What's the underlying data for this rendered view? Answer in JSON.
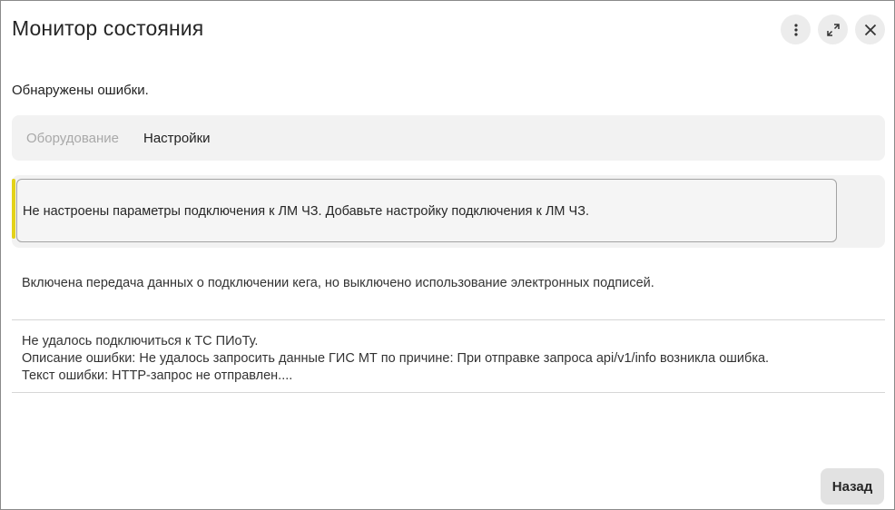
{
  "window": {
    "title": "Монитор состояния"
  },
  "summary": "Обнаружены ошибки.",
  "tabs": [
    {
      "label": "Оборудование",
      "active": false
    },
    {
      "label": "Настройки",
      "active": true
    }
  ],
  "messages": {
    "highlighted": "Не настроены параметры подключения к ЛМ ЧЗ. Добавьте настройку подключения к ЛМ ЧЗ.",
    "keg": "Включена передача данных о подключении кега, но выключено использование электронных подписей.",
    "piot": {
      "line1": "Не удалось подключиться к ТС ПИоТу.",
      "line2": "Описание ошибки: Не удалось запросить данные ГИС МТ по причине: При отправке запроса api/v1/info возникла ошибка.",
      "line3": "Текст ошибки: HTTP-запрос не отправлен...."
    }
  },
  "footer": {
    "back_label": "Назад"
  },
  "colors": {
    "accent": "#e3d21a",
    "panel_bg": "#f2f2f2",
    "button_bg": "#e2e2e2"
  },
  "icons": {
    "more": "more-vertical-icon",
    "expand": "expand-icon",
    "close": "close-icon"
  }
}
